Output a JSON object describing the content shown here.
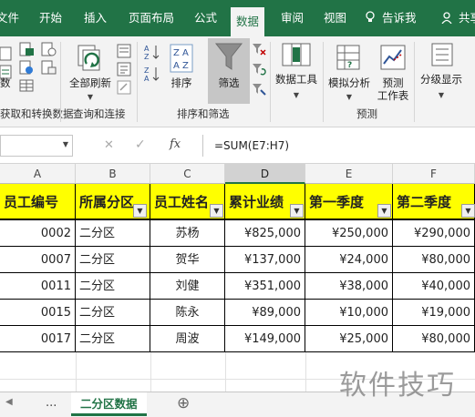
{
  "ribbon_tabs": {
    "file": "文件",
    "home": "开始",
    "insert": "插入",
    "layout": "页面布局",
    "formulas": "公式",
    "data": "数据",
    "review": "审阅",
    "view": "视图",
    "tell_me": "告诉我",
    "share": "共享"
  },
  "ribbon": {
    "get_transform": {
      "new_query_fragment": "数",
      "group_label": "获取和转换数据"
    },
    "queries": {
      "refresh_all": "全部刷新",
      "group_label": "查询和连接"
    },
    "sort_filter": {
      "sort": "排序",
      "filter": "筛选",
      "group_label": "排序和筛选"
    },
    "data_tools": {
      "label": "数据工具"
    },
    "forecast": {
      "what_if": "模拟分析",
      "forecast_sheet_line1": "预测",
      "forecast_sheet_line2": "工作表",
      "group_label": "预测"
    },
    "outline": {
      "label": "分级显示"
    }
  },
  "formula_bar": {
    "fx": "fx",
    "formula": "=SUM(E7:H7)"
  },
  "columns": [
    "A",
    "B",
    "C",
    "D",
    "E",
    "F"
  ],
  "selected_column": "D",
  "table": {
    "headers": [
      "员工编号",
      "所属分区",
      "员工姓名",
      "累计业绩",
      "第一季度",
      "第二季度"
    ],
    "rows": [
      {
        "id": "0002",
        "region": "二分区",
        "name": "苏杨",
        "total": "¥825,000",
        "q1": "¥250,000",
        "q2": "¥290,000"
      },
      {
        "id": "0007",
        "region": "二分区",
        "name": "贺华",
        "total": "¥137,000",
        "q1": "¥24,000",
        "q2": "¥80,000"
      },
      {
        "id": "0011",
        "region": "二分区",
        "name": "刘健",
        "total": "¥351,000",
        "q1": "¥38,000",
        "q2": "¥40,000"
      },
      {
        "id": "0015",
        "region": "二分区",
        "name": "陈永",
        "total": "¥89,000",
        "q1": "¥10,000",
        "q2": "¥19,000"
      },
      {
        "id": "0017",
        "region": "二分区",
        "name": "周波",
        "total": "¥149,000",
        "q1": "¥25,000",
        "q2": "¥80,000"
      }
    ]
  },
  "sheets": {
    "ellipsis": "...",
    "active": "二分区数据",
    "add": "⊕"
  },
  "watermark": "软件技巧",
  "colors": {
    "accent": "#217346",
    "header_fill": "#ffff00"
  }
}
